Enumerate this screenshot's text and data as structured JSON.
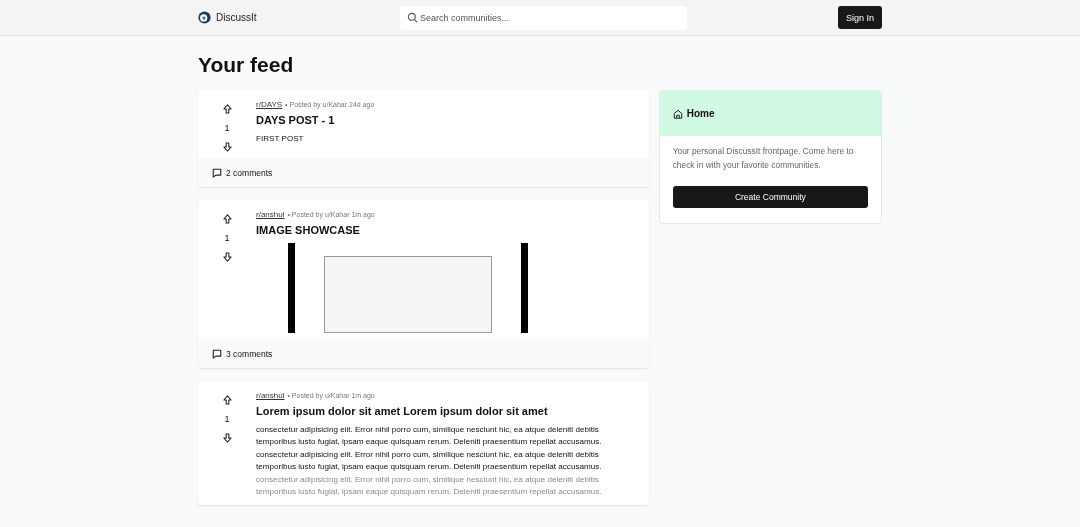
{
  "header": {
    "brand": "DiscussIt",
    "search": {
      "placeholder": "Search communities..."
    },
    "sign_in": "Sign In"
  },
  "feed": {
    "title": "Your feed",
    "posts": [
      {
        "subreddit": "r/DAYS",
        "meta": "• Posted by u/Kahar 24d ago",
        "votes": "1",
        "title": "DAYS POST - 1",
        "kind": "text",
        "body": [
          "FIRST POST"
        ],
        "comments": "2 comments"
      },
      {
        "subreddit": "r/anshul",
        "meta": "• Posted by u/Kahar 1m ago",
        "votes": "1",
        "title": "IMAGE SHOWCASE",
        "kind": "image",
        "comments": "3 comments"
      },
      {
        "subreddit": "r/anshul",
        "meta": "• Posted by u/Kahar 1m ago",
        "votes": "1",
        "title": "Lorem ipsum dolor sit amet Lorem ipsum dolor sit amet",
        "kind": "text",
        "body": [
          "consectetur adipisicing elit. Error nihil porro cum, similique nesciunt hic, ea atque deleniti debitis temporibus iusto fugiat, ipsam eaque quisquam rerum. Deleniti praesentium repellat accusamus.",
          "consectetur adipisicing elit. Error nihil porro cum, similique nesciunt hic, ea atque deleniti debitis temporibus iusto fugiat, ipsam eaque quisquam rerum. Deleniti praesentium repellat accusamus.",
          "consectetur adipisicing elit. Error nihil porro cum, similique nesciunt hic, ea atque deleniti debitis temporibus iusto fugiat, ipsam eaque quisquam rerum. Deleniti praesentium repellat accusamus."
        ]
      }
    ]
  },
  "sidebar": {
    "title": "Home",
    "text": "Your personal DiscussIt frontpage. Come here to check in with your favorite communities.",
    "button": "Create Community"
  }
}
